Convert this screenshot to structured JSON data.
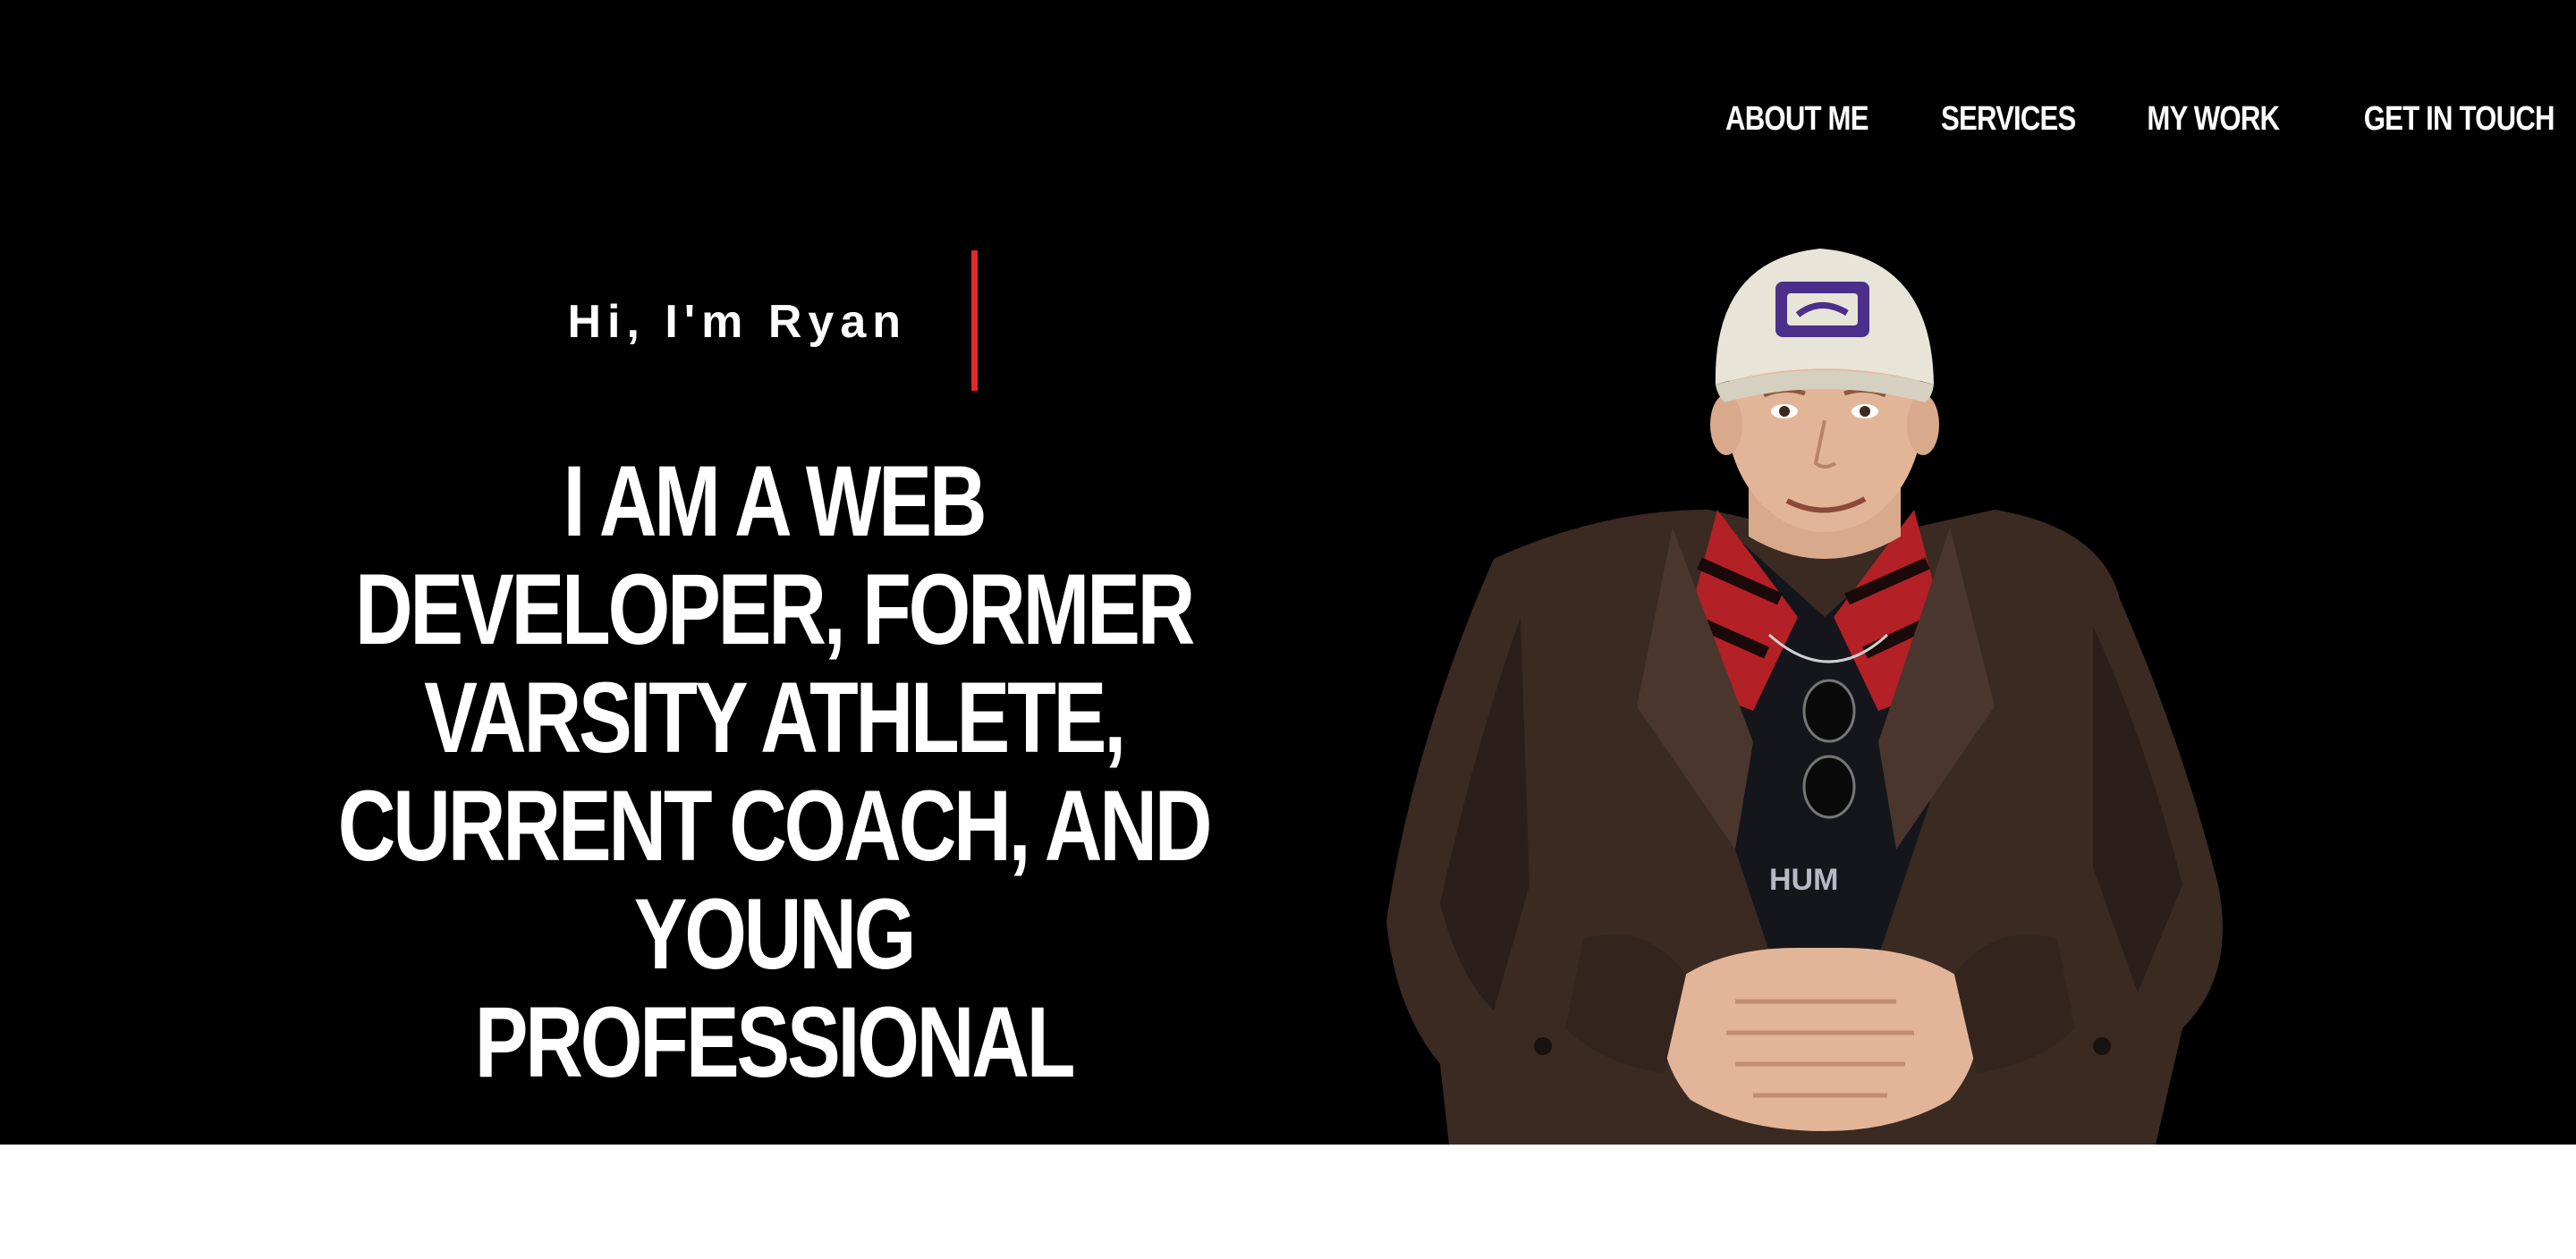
{
  "nav": {
    "items": [
      {
        "label": "ABOUT ME"
      },
      {
        "label": "SERVICES"
      },
      {
        "label": "MY WORK"
      },
      {
        "label": "GET IN TOUCH"
      }
    ]
  },
  "hero": {
    "greeting": "Hi, I'm Ryan",
    "headline": "I AM A WEB DEVELOPER, FORMER VARSITY ATHLETE, CURRENT COACH, AND YOUNG PROFESSIONAL",
    "shirt_text": "HUM"
  },
  "colors": {
    "background": "#000000",
    "accent": "#e02b27",
    "text": "#ffffff",
    "below_fold": "#ffffff"
  }
}
